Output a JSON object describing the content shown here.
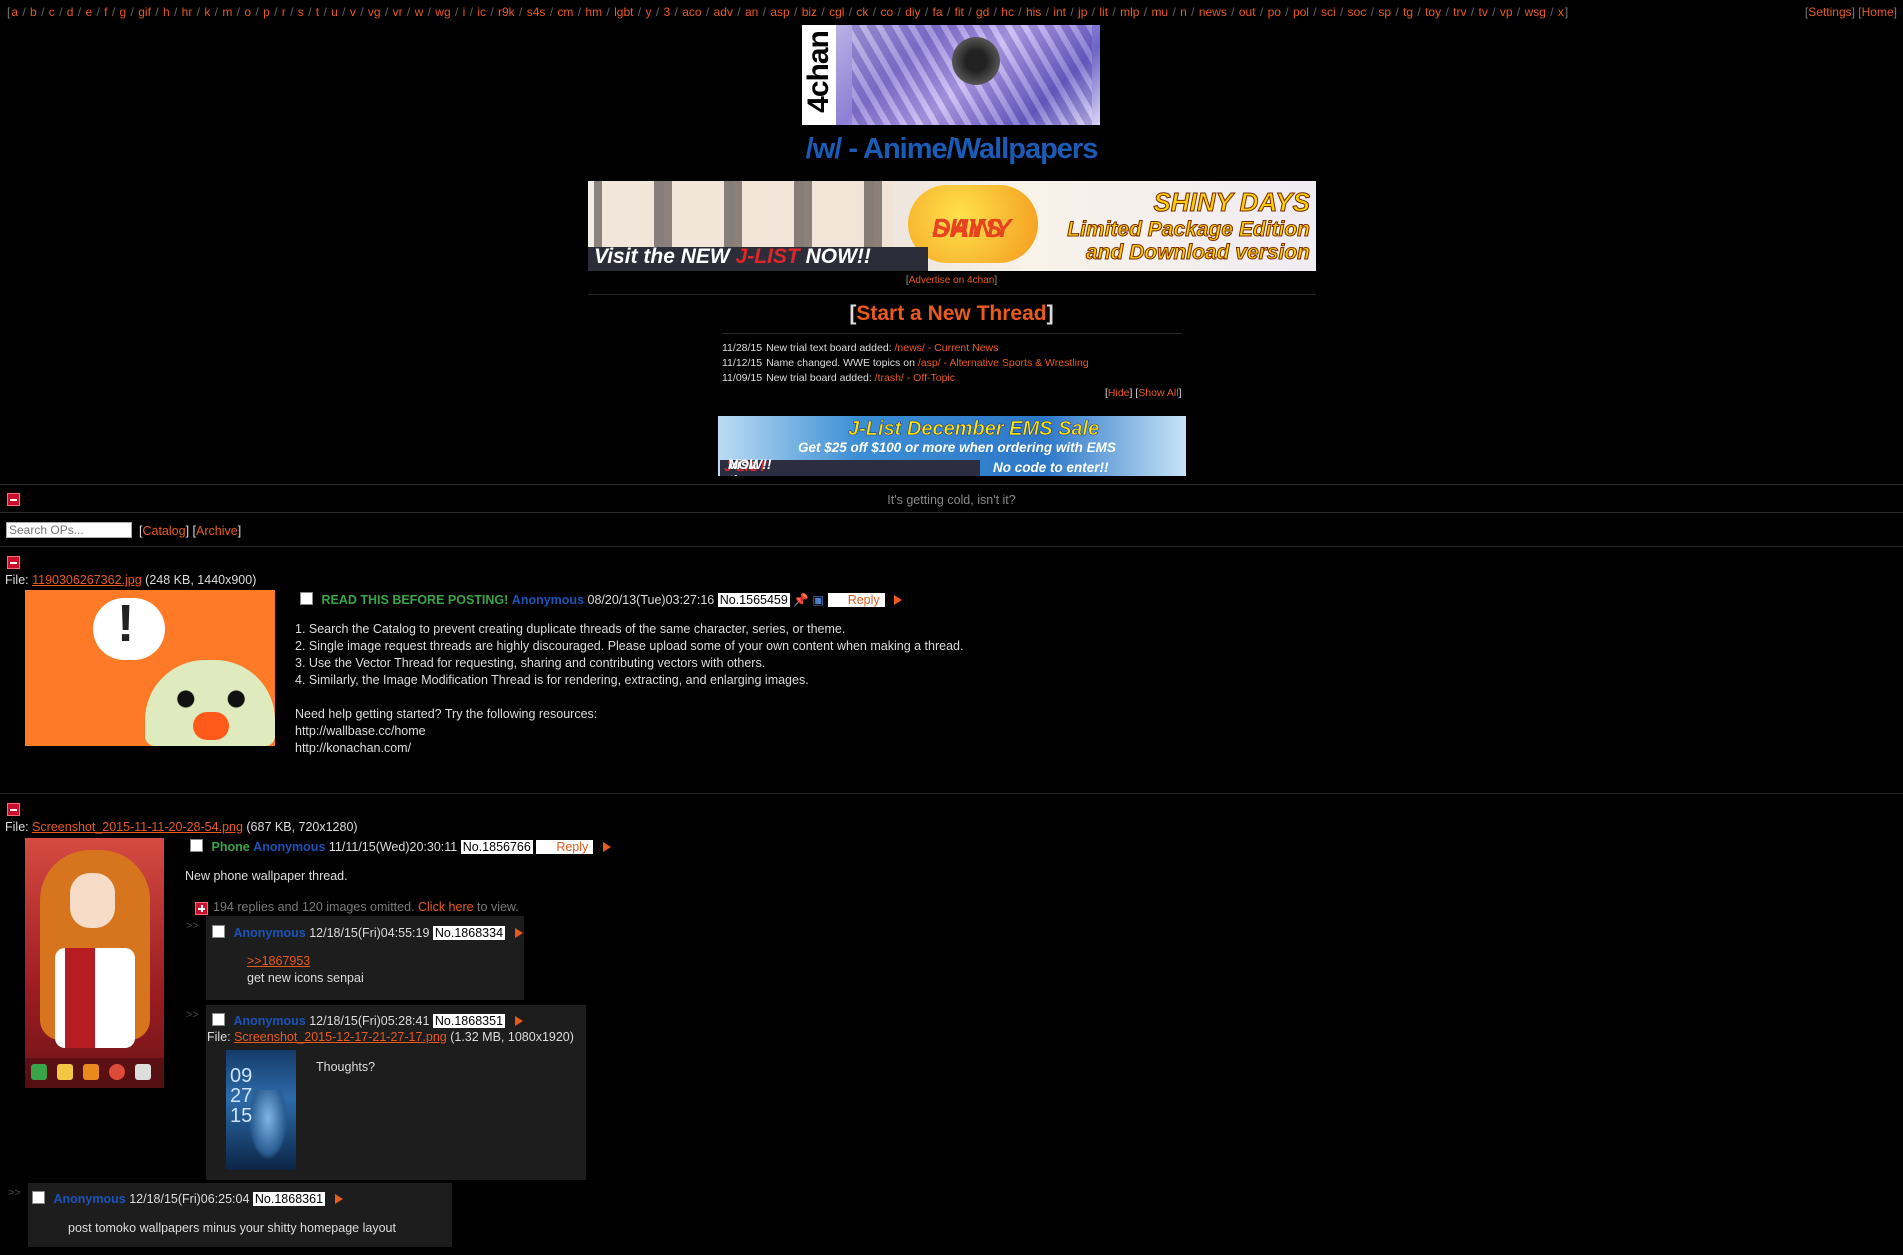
{
  "topnav": {
    "boards": [
      "a",
      "b",
      "c",
      "d",
      "e",
      "f",
      "g",
      "gif",
      "h",
      "hr",
      "k",
      "m",
      "o",
      "p",
      "r",
      "s",
      "t",
      "u",
      "v",
      "vg",
      "vr",
      "w",
      "wg",
      "i",
      "ic",
      "r9k",
      "s4s",
      "cm",
      "hm",
      "lgbt",
      "y",
      "3",
      "aco",
      "adv",
      "an",
      "asp",
      "biz",
      "cgl",
      "ck",
      "co",
      "diy",
      "fa",
      "fit",
      "gd",
      "hc",
      "his",
      "int",
      "jp",
      "lit",
      "mlp",
      "mu",
      "n",
      "news",
      "out",
      "po",
      "pol",
      "sci",
      "soc",
      "sp",
      "tg",
      "toy",
      "trv",
      "tv",
      "vp",
      "wsg",
      "x"
    ],
    "settings": "Settings",
    "home": "Home"
  },
  "header": {
    "logo_text": "4chan",
    "board_title": "/w/ - Anime/Wallpapers"
  },
  "ad_top": {
    "left_text_prefix": "Visit the NEW ",
    "left_text_brand": "J-LIST",
    "left_text_suffix": " NOW!!",
    "logo_line1": "SHINY",
    "logo_line2": "DAYS",
    "right_line1": "SHINY DAYS",
    "right_line2": "Limited Package Edition",
    "right_line3": "and Download version"
  },
  "advertise": "Advertise on 4chan",
  "start_thread": "Start a New Thread",
  "news": [
    {
      "date": "11/28/15",
      "text": "New trial text board added: ",
      "link": "/news/ - Current News"
    },
    {
      "date": "11/12/15",
      "text": "Name changed. WWE topics on ",
      "link": "/asp/ - Alternative Sports & Wrestling"
    },
    {
      "date": "11/09/15",
      "text": "New trial board added: ",
      "link": "/trash/ - Off-Topic"
    }
  ],
  "news_controls": {
    "hide": "Hide",
    "show_all": "Show All"
  },
  "ad_mid": {
    "line1": "J-List December EMS Sale",
    "line2": "Get $25 off $100 or more when ordering with EMS",
    "line3_prefix": "Visit the NEW ",
    "line3_brand": "J-LIST",
    "line3_suffix": " NOW!!",
    "line4": "No code to enter!!"
  },
  "motd": "It's getting cold, isn't it?",
  "search": {
    "placeholder": "Search OPs..."
  },
  "catalog_label": "Catalog",
  "archive_label": "Archive",
  "thread1": {
    "file_prefix": "File: ",
    "filename": "1190306267362.jpg",
    "filemeta": " (248 KB, 1440x900)",
    "subject": "READ THIS BEFORE POSTING!",
    "name": "Anonymous",
    "datetime": "08/20/13(Tue)03:27:16",
    "postno": "No.1565459",
    "reply": "Reply",
    "body": [
      "1. Search the Catalog to prevent creating duplicate threads of the same character, series, or theme.",
      "2. Single image request threads are highly discouraged. Please upload some of your own content when making a thread.",
      "3. Use the Vector Thread for requesting, sharing and contributing vectors with others.",
      "4. Similarly, the Image Modification Thread is for rendering, extracting, and enlarging images.",
      "",
      "Need help getting started? Try the following resources:",
      "http://wallbase.cc/home",
      "http://konachan.com/"
    ]
  },
  "thread2": {
    "file_prefix": "File: ",
    "filename": "Screenshot_2015-11-11-20-28-54.png",
    "filemeta": " (687 KB, 720x1280)",
    "subject": "Phone",
    "name": "Anonymous",
    "datetime": "11/11/15(Wed)20:30:11",
    "postno": "No.1856766",
    "reply": "Reply",
    "body": "New phone wallpaper thread.",
    "omitted_text": "194 replies and 120 images omitted. ",
    "omitted_link": "Click here",
    "omitted_suffix": " to view.",
    "replies": [
      {
        "name": "Anonymous",
        "datetime": "12/18/15(Fri)04:55:19",
        "postno": "No.1868334",
        "quote": ">>1867953",
        "text": "get new icons senpai"
      },
      {
        "name": "Anonymous",
        "datetime": "12/18/15(Fri)05:28:41",
        "postno": "No.1868351",
        "file_prefix": "File: ",
        "filename": "Screenshot_2015-12-17-21-27-17.png",
        "filemeta": " (1.32 MB, 1080x1920)",
        "text": "Thoughts?",
        "thumb_text": "09\n27\n15"
      },
      {
        "name": "Anonymous",
        "datetime": "12/18/15(Fri)06:25:04",
        "postno": "No.1868361",
        "text": "post tomoko wallpapers minus your shitty homepage layout"
      }
    ]
  },
  "colors": {
    "accent": "#e95a1d",
    "name": "#1b53b8",
    "subject": "#3aa548",
    "background": "#000000"
  }
}
